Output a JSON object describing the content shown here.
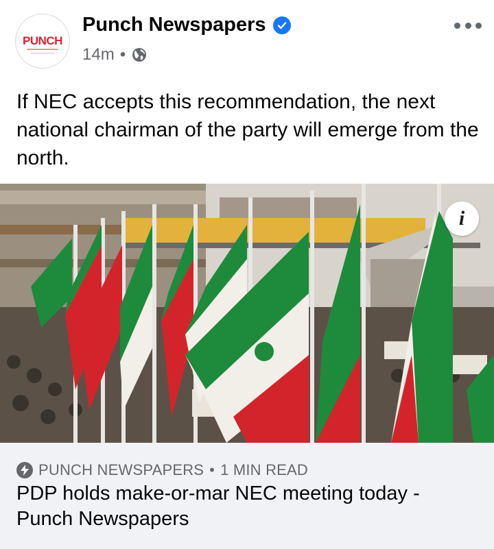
{
  "post": {
    "page_name": "Punch Newspapers",
    "avatar_logo_text": "PUNCH",
    "verified": true,
    "time": "14m",
    "separator": "•",
    "audience_icon": "globe-icon",
    "more_icon": "more-horizontal-icon",
    "text": "If NEC accepts this recommendation, the next national chairman of the party will emerge from the north."
  },
  "image": {
    "info_label": "i",
    "info_icon": "info-icon"
  },
  "link_card": {
    "source_icon": "bolt-icon",
    "source": "PUNCH NEWSPAPERS",
    "separator": "•",
    "read_time": "1 MIN READ",
    "title": "PDP holds make-or-mar NEC meeting today - Punch Newspapers"
  },
  "colors": {
    "verified_badge": "#1877f2",
    "flag_green": "#1e8a3c",
    "flag_red": "#d4242b",
    "card_background": "#f0f2f5",
    "secondary_text": "#65676b"
  }
}
